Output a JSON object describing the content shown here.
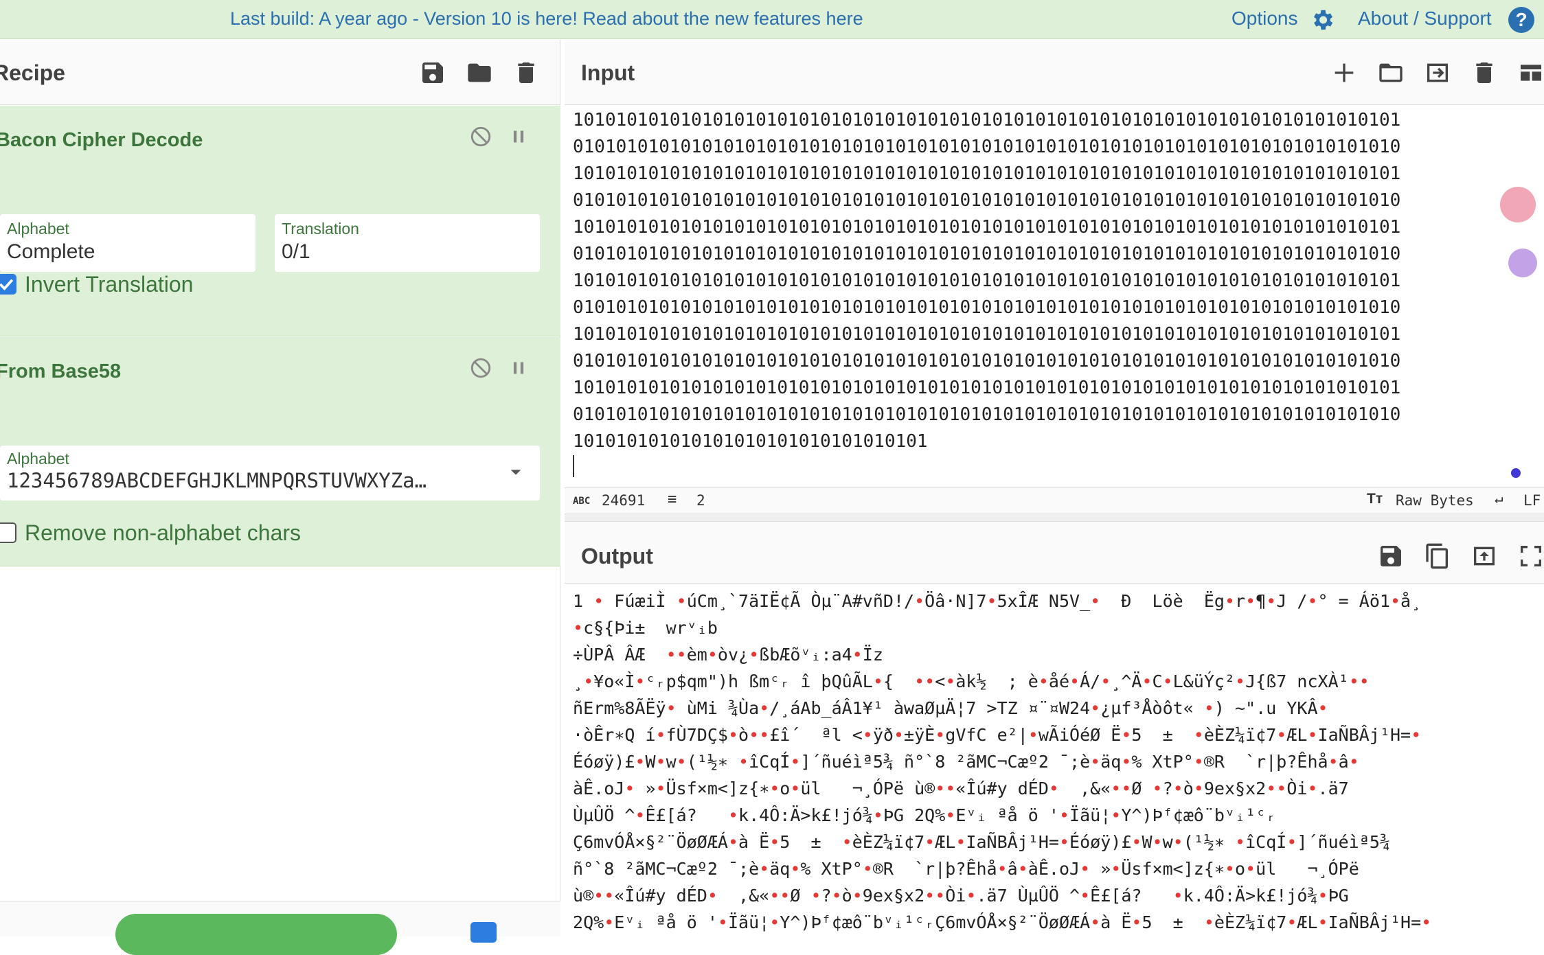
{
  "banner": {
    "message": "Last build: A year ago - Version 10 is here! Read about the new features here",
    "options": "Options",
    "about": "About / Support"
  },
  "recipe": {
    "title": "Recipe",
    "operations": [
      {
        "title": "Bacon Cipher Decode",
        "alphabet_label": "Alphabet",
        "alphabet_value": "Complete",
        "translation_label": "Translation",
        "translation_value": "0/1",
        "invert_label": "Invert Translation",
        "invert_checked": true
      },
      {
        "title": "From Base58",
        "alphabet_label": "Alphabet",
        "alphabet_value": "123456789ABCDEFGHJKLMNPQRSTUVWXYZa…",
        "remove_label": "Remove non-alphabet chars",
        "remove_checked": false
      }
    ]
  },
  "input": {
    "title": "Input",
    "lines": [
      "10101010101010101010101010101010101010101010101010101010101010101010101010101",
      "01010101010101010101010101010101010101010101010101010101010101010101010101010",
      "10101010101010101010101010101010101010101010101010101010101010101010101010101",
      "01010101010101010101010101010101010101010101010101010101010101010101010101010",
      "10101010101010101010101010101010101010101010101010101010101010101010101010101",
      "01010101010101010101010101010101010101010101010101010101010101010101010101010",
      "10101010101010101010101010101010101010101010101010101010101010101010101010101",
      "01010101010101010101010101010101010101010101010101010101010101010101010101010",
      "10101010101010101010101010101010101010101010101010101010101010101010101010101",
      "01010101010101010101010101010101010101010101010101010101010101010101010101010",
      "10101010101010101010101010101010101010101010101010101010101010101010101010101",
      "01010101010101010101010101010101010101010101010101010101010101010101010101010",
      "101010101010101010101010101010101"
    ],
    "char_count": "24691",
    "line_count": "2",
    "encoding": "Raw Bytes",
    "eol": "LF"
  },
  "output": {
    "title": "Output",
    "lines": [
      "1 • FúæiÌ •úCm¸`7äIË¢Ã Òµ¨A#vñD!/•Öâ·N]7•5xÎÆ N5V_•  Ð  Löè  Ëg•r•¶•J /•° = Áö1•å¸",
      "•c§{Þi±  wrᵛᵢb",
      "÷ÙPÂ ÂÆ  ••èm•òv¿•ßbÆõᵛᵢ:a4•Ïz",
      "¸•¥o«Ì•ᶜᵣp$qm\")h ßmᶜᵣ î þQûÃL•{  ••<•àk½  ; è•åé•Á/•¸^Ä•C•L&üÝç²•J{ß7 ncXÀ¹••",
      "ñErm%8ÃËÿ• ùMi ¾Ùa•/¸áAb_áÂ1¥¹ àwaØµÄ¦7 >TZ ¤¨¤W24•¿µf³Åòôt« •) ~\".u YKÂ•",
      "·òÊr∗Q í•fÙ7DÇ$•ò••£î´  ªl <•ÿð•±ÿÈ•gVfC e²|•wÃiÓéØ Ë•5  ±  •èÈZ¼ï¢7•ÆL•IaÑBÂj¹H=•",
      "Éóøÿ)£•W•w•(¹½∗ •îCqÍ•]´ñuéìª5¾ ñ°`8 ²ãMC¬Cæº2 ¯;è•äq•% XtP°•®R  `r|þ?Êhå•â•",
      "àÊ.oJ• »•Üsf×m<]z{∗•o•ül   ¬¸ÓPë ù®••«Îú#y dÉD•  ,&«••Ø •?•ò•9ex§x2••Òi•.ä7",
      "ÙµÛÖ ^•Ê£[á?   •k.4Ô:Ä>k£!jó¾•ÞG 2Q%•Eᵛᵢ ªå ö '•Ïãü¦•Y^)Þᶠ¢æô¨bᵛᵢ¹ᶜᵣ",
      "Ç6mvÓÅ×§²¨ÖøØÆÁ•à Ë•5  ±  •èÈZ¼ï¢7•ÆL•IaÑBÂj¹H=•Éóøÿ)£•W•w•(¹½∗ •îCqÍ•]´ñuéìª5¾",
      "ñ°`8 ²ãMC¬Cæº2 ¯;è•äq•% XtP°•®R  `r|þ?Êhå•â•àÊ.oJ• »•Üsf×m<]z{∗•o•ül   ¬¸ÓPë",
      "ù®••«Îú#y dÉD•  ,&«••Ø •?•ò•9ex§x2••Òi•.ä7 ÙµÛÖ ^•Ê£[á?   •k.4Ô:Ä>k£!jó¾•ÞG",
      "2Q%•Eᵛᵢ ªå ö '•Ïãü¦•Y^)Þᶠ¢æô¨bᵛᵢ¹ᶜᵣÇ6mvÓÅ×§²¨ÖøØÆÁ•à Ë•5  ±  •èÈZ¼ï¢7•ÆL•IaÑBÂj¹H=•"
    ]
  },
  "colors": {
    "banner_bg": "#dff0d8",
    "link": "#2a6fb0",
    "op_bg": "#dff0d8",
    "op_text": "#3c763d",
    "checkbox": "#2d7de0",
    "control_char_dot": "#e53935"
  }
}
